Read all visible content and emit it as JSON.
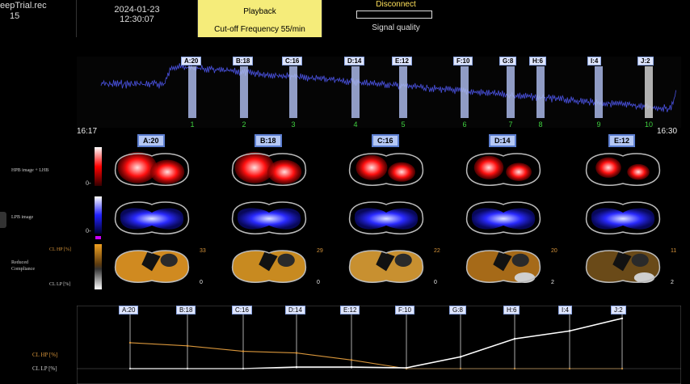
{
  "header": {
    "file_name": "eepTrial.rec",
    "file_number": "15",
    "date": "2024-01-23",
    "time": "12:30:07",
    "mode": "Playback",
    "filter": "Cut-off Frequency 55/min",
    "disconnect": "Disconnect",
    "signal_quality": "Signal quality"
  },
  "trend": {
    "start_time": "16:17",
    "end_time": "16:30",
    "markers": [
      {
        "label": "A:20",
        "index": "1"
      },
      {
        "label": "B:18",
        "index": "2"
      },
      {
        "label": "C:16",
        "index": "3"
      },
      {
        "label": "D:14",
        "index": "4"
      },
      {
        "label": "E:12",
        "index": "5"
      },
      {
        "label": "F:10",
        "index": "6"
      },
      {
        "label": "G:8",
        "index": "7"
      },
      {
        "label": "H:6",
        "index": "8"
      },
      {
        "label": "I:4",
        "index": "9"
      },
      {
        "label": "J:2",
        "index": "10"
      }
    ]
  },
  "rows": {
    "hpb_label": "HPB image + LHB",
    "lpb_label": "LPB image",
    "cl_hp_label": "CL HP [%]",
    "reduced_label": "Reduced",
    "compliance_label": "Compliance",
    "cl_lp_label": "CL LP [%]",
    "zero": "0-"
  },
  "panels": [
    {
      "label": "A:20",
      "cl_hp": "33",
      "cl_lp": "0"
    },
    {
      "label": "B:18",
      "cl_hp": "29",
      "cl_lp": "0"
    },
    {
      "label": "C:16",
      "cl_hp": "22",
      "cl_lp": "0"
    },
    {
      "label": "D:14",
      "cl_hp": "20",
      "cl_lp": "2"
    },
    {
      "label": "E:12",
      "cl_hp": "11",
      "cl_lp": "2"
    }
  ],
  "bottom_chart": {
    "hp_label": "CL HP [%]",
    "lp_label": "CL LP [%]",
    "colors": {
      "hp": "#d9963b",
      "lp": "#ffffff"
    }
  },
  "chart_data": {
    "type": "line",
    "categories": [
      "A:20",
      "B:18",
      "C:16",
      "D:14",
      "E:12",
      "F:10",
      "G:8",
      "H:6",
      "I:4",
      "J:2"
    ],
    "series": [
      {
        "name": "CL HP [%]",
        "values": [
          33,
          29,
          22,
          20,
          11,
          0,
          0,
          0,
          0,
          0
        ]
      },
      {
        "name": "CL LP [%]",
        "values": [
          0,
          0,
          0,
          2,
          2,
          1,
          15,
          38,
          48,
          64
        ]
      }
    ],
    "ylim": [
      0,
      70
    ]
  }
}
